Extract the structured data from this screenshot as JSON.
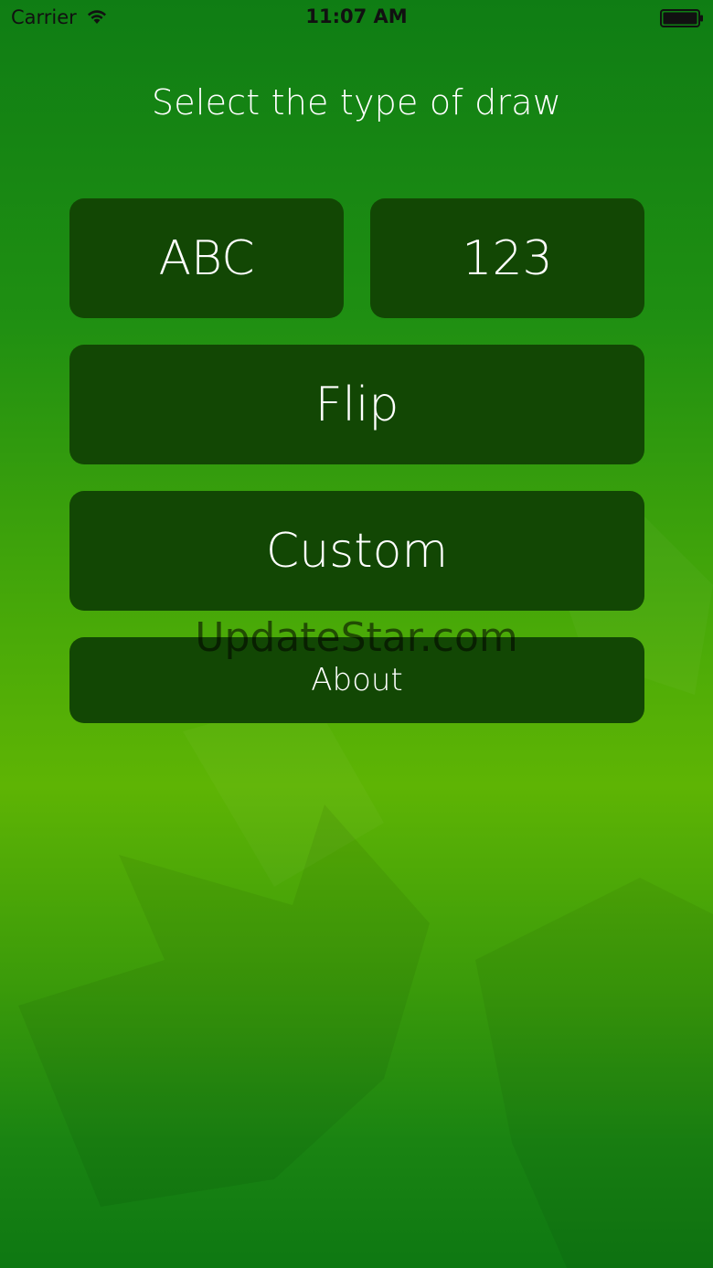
{
  "status_bar": {
    "carrier": "Carrier",
    "time": "11:07 AM",
    "wifi_icon": "wifi-icon",
    "battery_icon": "battery-full-icon"
  },
  "title": "Select the type of draw",
  "buttons": {
    "abc": "ABC",
    "numbers": "123",
    "flip": "Flip",
    "custom": "Custom",
    "about": "About"
  },
  "watermark": "UpdateStar.com",
  "colors": {
    "button_bg": "#124704",
    "text": "#ffffff",
    "background_top": "#0f7d14",
    "background_mid": "#5eb404"
  }
}
